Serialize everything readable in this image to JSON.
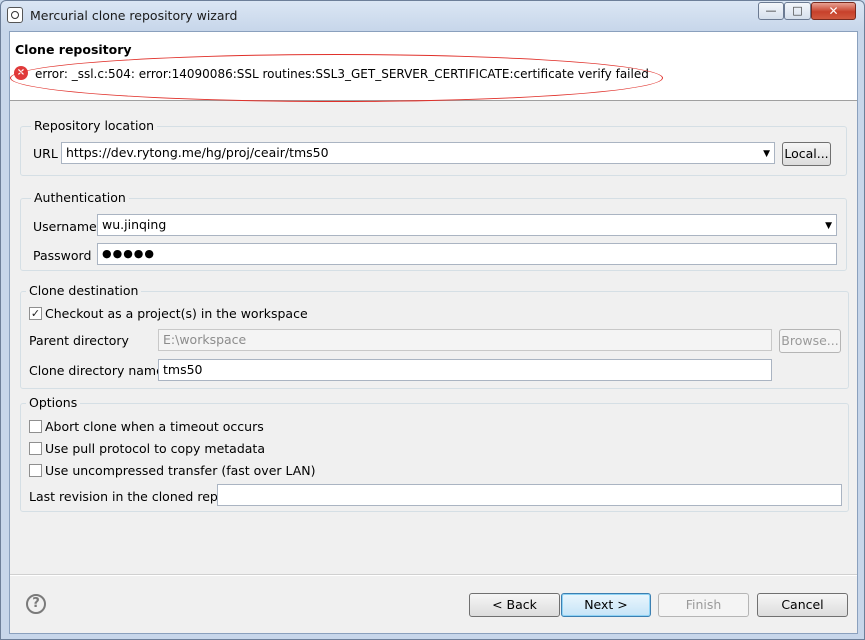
{
  "window": {
    "title": "Mercurial clone repository wizard"
  },
  "banner": {
    "title": "Clone repository",
    "error_message": "error: _ssl.c:504: error:14090086:SSL routines:SSL3_GET_SERVER_CERTIFICATE:certificate verify failed"
  },
  "repository_location": {
    "legend": "Repository location",
    "url_label": "URL",
    "url_value": "https://dev.rytong.me/hg/proj/ceair/tms50",
    "local_button": "Local..."
  },
  "authentication": {
    "legend": "Authentication",
    "username_label": "Username",
    "username_value": "wu.jinqing",
    "password_label": "Password",
    "password_value": "●●●●●"
  },
  "clone_destination": {
    "legend": "Clone destination",
    "checkout_label": "Checkout as a project(s) in the workspace",
    "checkout_checked": true,
    "parent_dir_label": "Parent directory",
    "parent_dir_value": "E:\\workspace",
    "browse_button": "Browse...",
    "clone_dir_label": "Clone directory name",
    "clone_dir_value": "tms50"
  },
  "options": {
    "legend": "Options",
    "abort_label": "Abort clone when a timeout occurs",
    "pull_label": "Use pull protocol to copy metadata",
    "uncompressed_label": "Use uncompressed transfer (fast over LAN)",
    "last_revision_label": "Last revision in the cloned repo",
    "last_revision_value": ""
  },
  "footer": {
    "back": "< Back",
    "next": "Next >",
    "finish": "Finish",
    "cancel": "Cancel"
  },
  "icons": {
    "app": "mercurial-app-icon",
    "error": "error-icon",
    "help": "help-icon",
    "dropdown": "chevron-down-icon"
  },
  "colors": {
    "error_red": "#e03a3a",
    "annotation_red": "#e0302a"
  }
}
